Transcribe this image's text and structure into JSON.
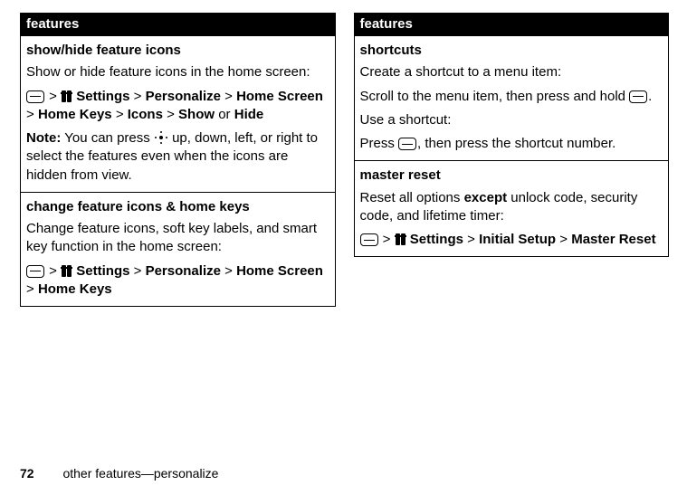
{
  "left": {
    "header": "features",
    "sections": [
      {
        "title": "show/hide feature icons",
        "desc": "Show or hide feature icons in the home screen:",
        "path": {
          "settings": "Settings",
          "personalize": "Personalize",
          "homescreen": "Home Screen",
          "homekeys": "Home Keys",
          "icons": "Icons",
          "show": "Show",
          "or": "or",
          "hide": "Hide"
        },
        "note_label": "Note:",
        "note_text": "You can press",
        "note_after": "up, down, left, or right to select the features even when the icons are hidden from view."
      },
      {
        "title": "change feature icons & home keys",
        "desc": "Change feature icons, soft key labels, and smart key function in the home screen:",
        "path": {
          "settings": "Settings",
          "personalize": "Personalize",
          "homescreen": "Home Screen",
          "homekeys": "Home Keys"
        }
      }
    ]
  },
  "right": {
    "header": "features",
    "sections": [
      {
        "title": "shortcuts",
        "line1": "Create a shortcut to a menu item:",
        "line2a": "Scroll to the menu item, then press and hold",
        "line2b": ".",
        "line3": "Use a shortcut:",
        "line4a": "Press",
        "line4b": ", then press the shortcut number."
      },
      {
        "title": "master reset",
        "desc_a": "Reset all options",
        "desc_bold": "except",
        "desc_b": "unlock code, security code, and lifetime timer:",
        "path": {
          "settings": "Settings",
          "initial": "Initial Setup",
          "master": "Master Reset"
        }
      }
    ]
  },
  "footer": {
    "page": "72",
    "text": "other features—personalize"
  },
  "gt": ">"
}
